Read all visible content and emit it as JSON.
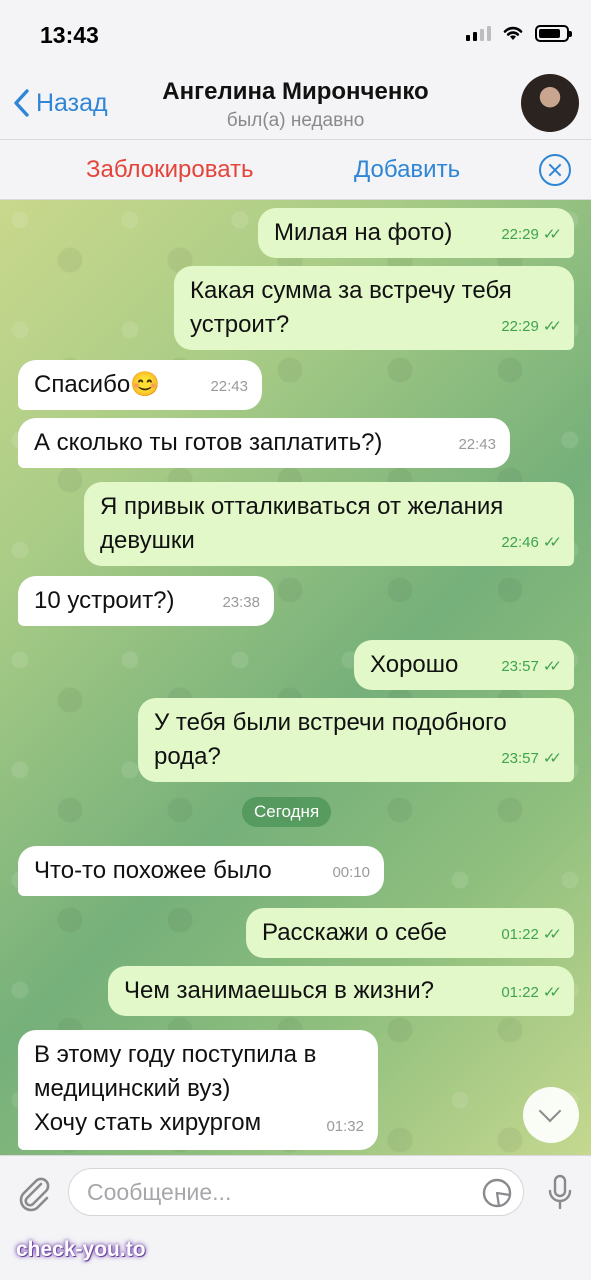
{
  "status_bar": {
    "time": "13:43"
  },
  "header": {
    "back_label": "Назад",
    "contact_name": "Ангелина Миронченко",
    "contact_status": "был(а) недавно"
  },
  "action_bar": {
    "block_label": "Заблокировать",
    "add_label": "Добавить"
  },
  "messages": [
    {
      "direction": "out",
      "text": "Милая на фото)",
      "time": "22:29",
      "read": true
    },
    {
      "direction": "out",
      "text": "Какая сумма за встречу тебя\nустроит?",
      "time": "22:29",
      "read": true
    },
    {
      "direction": "in",
      "text": "Спасибо😊",
      "time": "22:43"
    },
    {
      "direction": "in",
      "text": "А сколько ты готов заплатить?)",
      "time": "22:43"
    },
    {
      "direction": "out",
      "text": "Я привык отталкиваться от желания\nдевушки",
      "time": "22:46",
      "read": true
    },
    {
      "direction": "in",
      "text": "10 устроит?)",
      "time": "23:38"
    },
    {
      "direction": "out",
      "text": "Хорошо",
      "time": "23:57",
      "read": true
    },
    {
      "direction": "out",
      "text": "У тебя были встречи подобного\nрода?",
      "time": "23:57",
      "read": true
    },
    {
      "direction": "in",
      "text": "Что-то похожее было",
      "time": "00:10"
    },
    {
      "direction": "out",
      "text": "Расскажи о себе",
      "time": "01:22",
      "read": true
    },
    {
      "direction": "out",
      "text": "Чем занимаешься в жизни?",
      "time": "01:22",
      "read": true
    },
    {
      "direction": "in",
      "text": "В этому году поступила в\nмедицинский вуз)\nХочу стать хирургом",
      "time": "01:32"
    }
  ],
  "date_separator": "Сегодня",
  "input": {
    "placeholder": "Сообщение..."
  },
  "watermark": "check-you.to",
  "icons": {
    "back": "chevron-left-icon",
    "close": "close-circle-icon",
    "attach": "paperclip-icon",
    "sticker": "sticker-icon",
    "mic": "microphone-icon",
    "scroll": "chevron-down-icon"
  },
  "colors": {
    "accent": "#2f86d6",
    "danger": "#e5443a",
    "outgoing_bubble": "#e2f8c9",
    "read_tick": "#3fa34d"
  }
}
